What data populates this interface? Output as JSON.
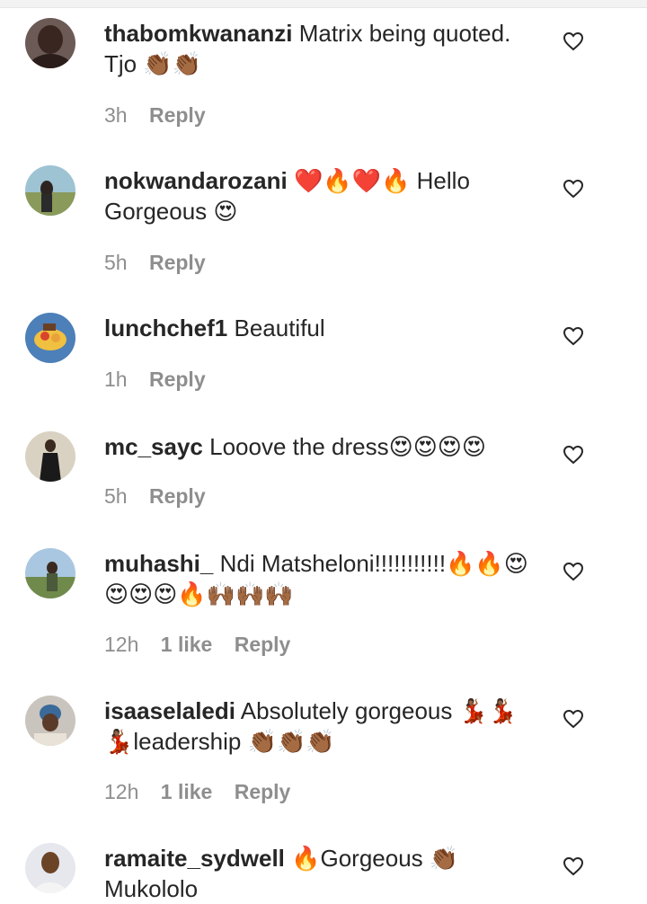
{
  "comments": [
    {
      "username": "thabomkwananzi",
      "text": "Matrix being quoted. Tjo 👏🏾👏🏾",
      "time": "3h",
      "likes": "",
      "reply": "Reply"
    },
    {
      "username": "nokwandarozani",
      "text": "❤️🔥❤️🔥 Hello Gorgeous 😍",
      "time": "5h",
      "likes": "",
      "reply": "Reply"
    },
    {
      "username": "lunchchef1",
      "text": "Beautiful",
      "time": "1h",
      "likes": "",
      "reply": "Reply"
    },
    {
      "username": "mc_sayc",
      "text": "Looove the dress😍😍😍😍",
      "time": "5h",
      "likes": "",
      "reply": "Reply"
    },
    {
      "username": "muhashi_",
      "text": "Ndi Matsheloni!!!!!!!!!!!🔥🔥😍😍😍😍🔥🙌🏾🙌🏾🙌🏾",
      "time": "12h",
      "likes": "1 like",
      "reply": "Reply"
    },
    {
      "username": "isaaselaledi",
      "text": "Absolutely gorgeous 💃🏾💃🏾💃🏾leadership 👏🏾👏🏾👏🏾",
      "time": "12h",
      "likes": "1 like",
      "reply": "Reply"
    },
    {
      "username": "ramaite_sydwell",
      "text": "🔥Gorgeous 👏🏾 Mukololo",
      "time": "",
      "likes": "",
      "reply": ""
    }
  ],
  "colors": {
    "text": "#262626",
    "meta": "#8e8e8e",
    "background": "#ffffff"
  },
  "icons": {
    "like": "heart-outline-icon",
    "avatar": "profile-avatar"
  }
}
